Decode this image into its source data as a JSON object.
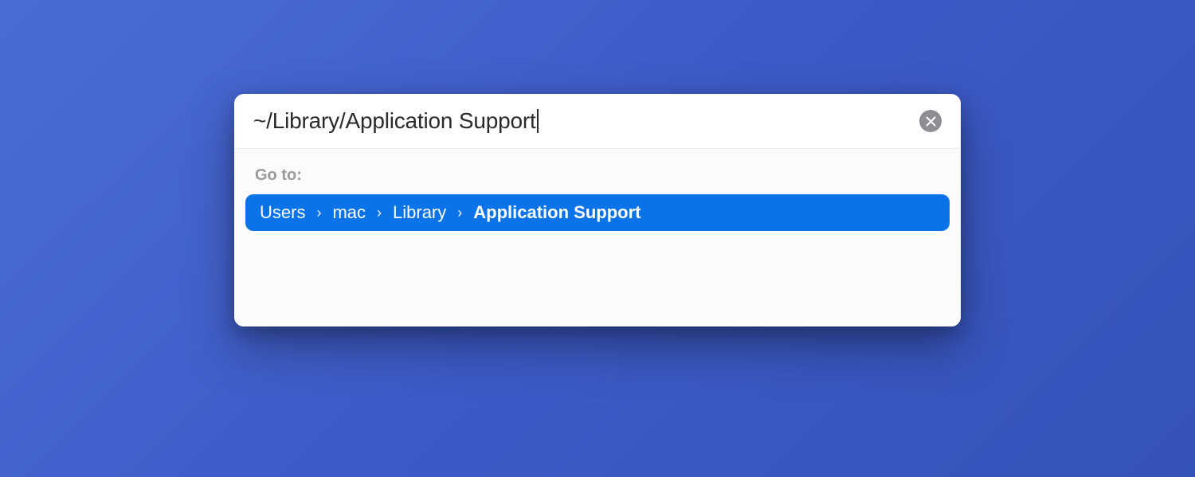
{
  "search": {
    "value": "~/Library/Application Support"
  },
  "results": {
    "label": "Go to:",
    "breadcrumb": {
      "parts": [
        "Users",
        "mac",
        "Library",
        "Application Support"
      ],
      "bold_last": true,
      "separator": "›"
    }
  },
  "colors": {
    "selection": "#0b73e8",
    "background": "#3d5bc7"
  }
}
